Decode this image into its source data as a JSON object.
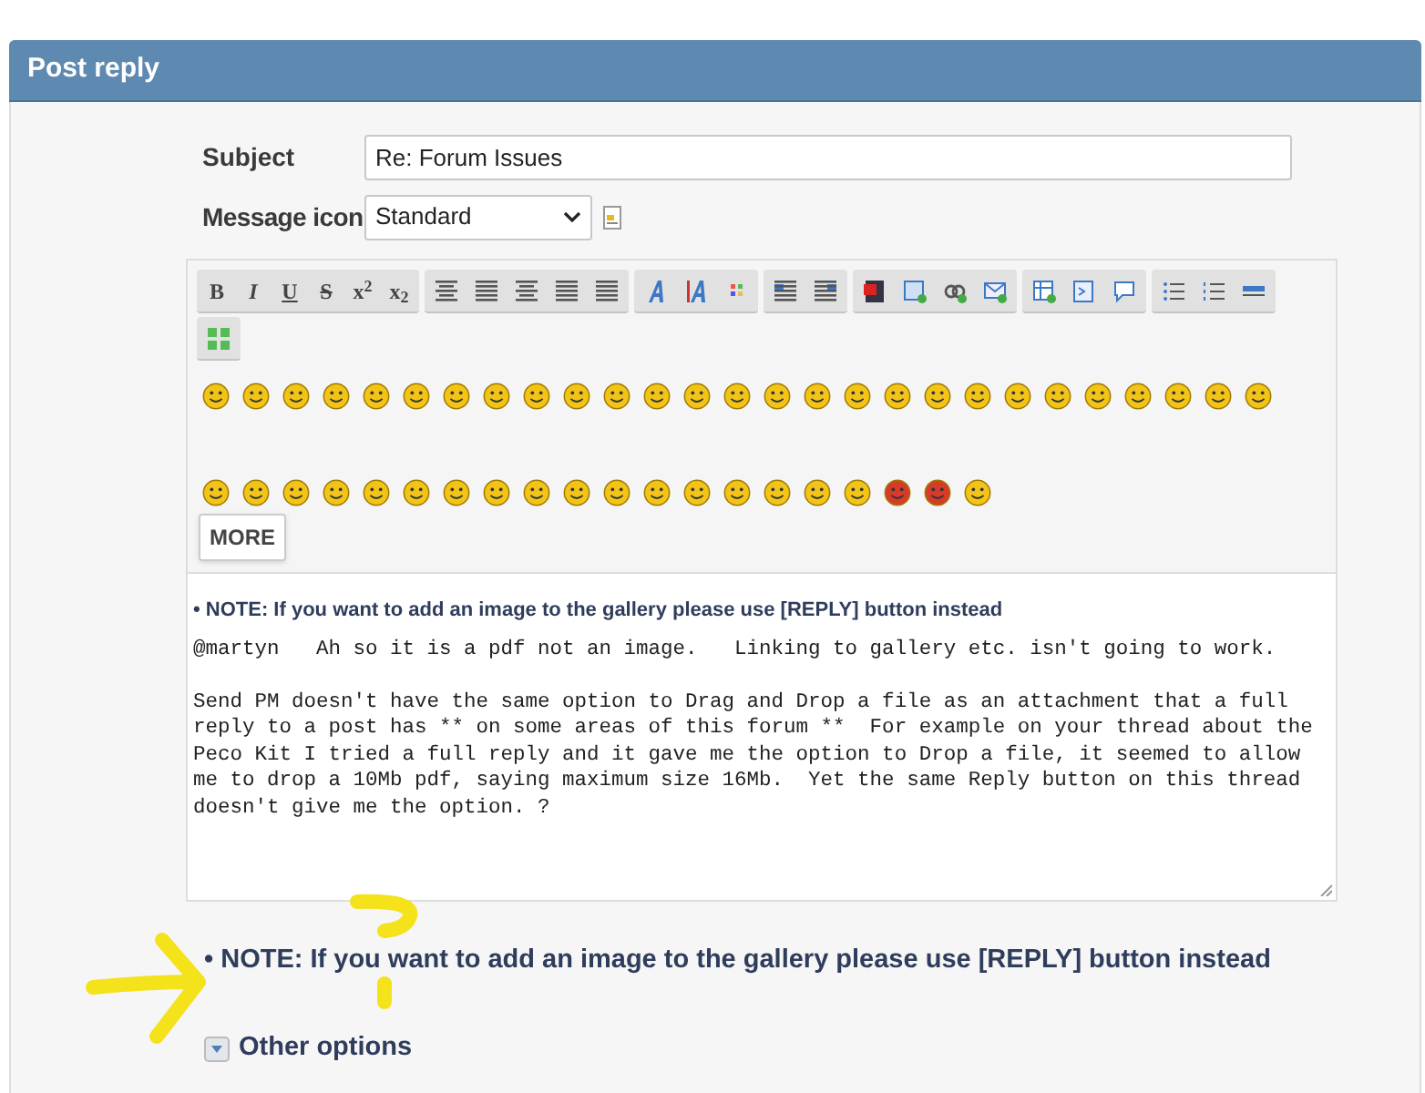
{
  "header": {
    "title": "Post reply"
  },
  "subject": {
    "label": "Subject",
    "value": "Re: Forum Issues"
  },
  "message_icon": {
    "label": "Message icon",
    "value": "Standard"
  },
  "toolbar": {
    "format_buttons": [
      "B",
      "I",
      "U",
      "S",
      "x$^{2}$",
      "x$_{2}$"
    ]
  },
  "more_button": "MORE",
  "editor": {
    "note": "• NOTE: If you want to add an image to the gallery please use [REPLY] button instead",
    "text": "@martyn   Ah so it is a pdf not an image.   Linking to gallery etc. isn't going to work.\n\nSend PM doesn't have the same option to Drag and Drop a file as an attachment that a full\nreply to a post has ** on some areas of this forum **  For example on your thread about the\nPeco Kit I tried a full reply and it gave me the option to Drop a file, it seemed to allow\nme to drop a 10Mb pdf, saying maximum size 16Mb.  Yet the same Reply button on this thread\ndoesn't give me the option. ?"
  },
  "note": "• NOTE: If you want to add an image to the gallery please use [REPLY] button instead",
  "other_options": {
    "label": "Other options",
    "expanded": false
  }
}
